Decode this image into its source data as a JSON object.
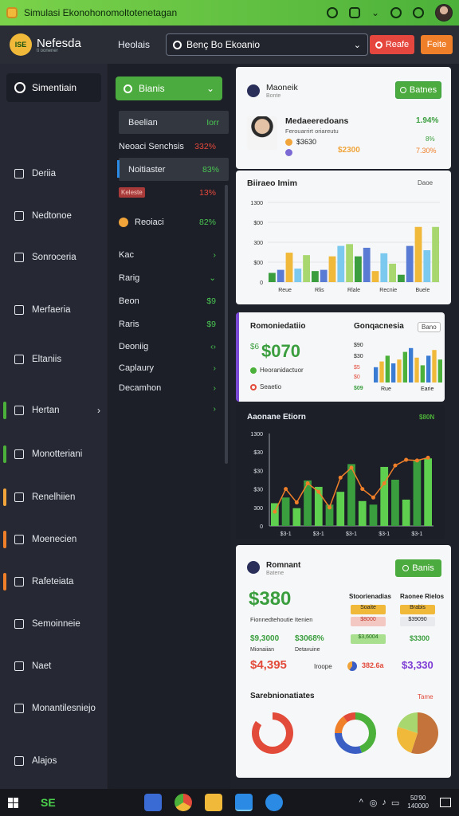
{
  "window": {
    "title": "Simulasi Ekonohonomoltotenetagan"
  },
  "header": {
    "brand": "Nefesda",
    "brand_sub": "ti oonener",
    "logo_text": "ISE",
    "label": "Heolais",
    "search": {
      "value": "Benç  Bo  Ekoanio"
    },
    "btn_red": "Reafe",
    "btn_orange": "Feite"
  },
  "sidebar": {
    "top": "Simentiain",
    "items": [
      {
        "label": "Deriia",
        "icon": "dashboard-icon"
      },
      {
        "label": "Nedtonoe",
        "icon": "notes-icon"
      },
      {
        "label": "Sonroceria",
        "icon": "settings-icon"
      },
      {
        "label": "Merfaeria",
        "icon": "chart-icon"
      },
      {
        "label": "Eltaniis",
        "icon": "gear-icon"
      },
      {
        "label": "Hertan",
        "icon": "folder-icon",
        "accent": "#4cb13a",
        "arrow": "›"
      },
      {
        "label": "Monotteriani",
        "icon": "list-icon",
        "accent": "#4cb13a"
      },
      {
        "label": "Renelhiien",
        "icon": "mail-icon",
        "accent": "#f0a43a"
      },
      {
        "label": "Moenecien",
        "icon": "calendar-icon",
        "accent": "#f07f2a"
      },
      {
        "label": "Rafeteiata",
        "icon": "report-icon",
        "accent": "#f07f2a"
      },
      {
        "label": "Semoinneie",
        "icon": "people-icon"
      },
      {
        "label": "Naet",
        "icon": "globe-icon"
      },
      {
        "label": "Monantilesniejo",
        "icon": "message-icon"
      },
      {
        "label": "Alajos",
        "icon": "help-icon"
      }
    ]
  },
  "mid": {
    "button": "Bianis",
    "rows": [
      {
        "label": "Beelian",
        "value": "Iorr",
        "color": "green",
        "selected": true
      },
      {
        "label": "Neoaci Senchsis",
        "value": "332%",
        "color": "red"
      },
      {
        "label": "Noitiaster",
        "value": "83%",
        "color": "green",
        "selected": true
      },
      {
        "label": "Keleste",
        "value": "13%",
        "color": "red",
        "badge": true
      },
      {
        "label": "Reoiaci",
        "value": "82%",
        "color": "green",
        "coin": true
      },
      {
        "label": "Kac",
        "value": "›",
        "color": "green"
      },
      {
        "label": "Rarig",
        "value": "⌄",
        "color": "green"
      },
      {
        "label": "Beon",
        "value": "$9",
        "color": "green"
      },
      {
        "label": "Raris",
        "value": "$9",
        "color": "green"
      },
      {
        "label": "Deoniig",
        "value": "‹›",
        "color": "green"
      },
      {
        "label": "Caplaury",
        "value": "›",
        "color": "green"
      },
      {
        "label": "Decamhon",
        "value": "›",
        "color": "green"
      },
      {
        "label": "",
        "value": "›",
        "color": "green"
      }
    ]
  },
  "card1": {
    "title": "Maoneik",
    "sub": "Bonte",
    "button": "Batnes",
    "name": "Medaeeredoans",
    "line": "Ferouarrirt oriareutu",
    "amount": "$3630",
    "stat1": "1.94%",
    "stat2": "8%",
    "stat3": "$2300",
    "stat4": "7.30%"
  },
  "chart1": {
    "title": "Biiraeo Imim",
    "corner": "Daoe"
  },
  "card2": {
    "title": "Romoniedatiio",
    "mid_title": "Gonqacnesia",
    "tag": "Bano",
    "big_value": "$070",
    "big_prefix": "$6",
    "line1": "Heoranidactuor",
    "line2": "Seaetio",
    "yl": [
      "$90",
      "$30",
      "$5",
      "$0"
    ],
    "xl": [
      "$09",
      "Rue",
      "Earie"
    ]
  },
  "chart2": {
    "title": "Aaonane Etiorn",
    "corner": "$80N"
  },
  "card3": {
    "title": "Romnant",
    "sub": "Batene",
    "button": "Banis",
    "big_value": "$380",
    "big_sub": "Fionnedtehoutie Itenien",
    "h1": "Stoorienadias",
    "h2": "Raonee Rielos",
    "pills": [
      "Soaite",
      "Brabis",
      "$8000",
      "$39090"
    ],
    "v1": "$9,3000",
    "v2": "$3068%",
    "sub1": "Mionaiian",
    "sub2": "Detavuine",
    "red_big": "$4,395",
    "mid_word": "Iroope",
    "mid_value": "382.6a",
    "purple": "$3,330",
    "v3": "$3,6004",
    "v4": "$3300",
    "section": "Sarebnionatiates",
    "section_tag": "Tame"
  },
  "taskbar": {
    "app_label": "SE",
    "time": "50'90",
    "date": "140000"
  },
  "chart_data": [
    {
      "type": "bar",
      "title": "Biiraeo Imim",
      "ylim": [
        0,
        1300
      ],
      "y_ticks": [
        "0",
        "$00",
        "300",
        "$00",
        "1300"
      ],
      "x_ticks": [
        "Reue",
        "Rlis",
        "Rlale",
        "Recnie",
        "Buele"
      ],
      "series": [
        {
          "values": [
            150,
            200,
            480,
            220,
            440,
            180,
            200,
            420,
            590,
            620,
            420,
            560,
            180,
            470,
            300,
            120,
            590,
            900,
            520,
            900
          ]
        }
      ],
      "colors": [
        "#3a9e3e",
        "#5a7bd4",
        "#f0b93a",
        "#7bc9ee",
        "#a8d770"
      ]
    },
    {
      "type": "bar",
      "title": "Gonqacnesia",
      "values": [
        40,
        55,
        70,
        50,
        60,
        80,
        90,
        65,
        45,
        70,
        85,
        60
      ],
      "colors": [
        "#3a7bd4",
        "#f0b93a",
        "#4cb13a"
      ]
    },
    {
      "type": "bar",
      "title": "Aaonane Etiorn",
      "ylim": [
        0,
        1300
      ],
      "y_ticks": [
        "0",
        "300",
        "$30",
        "$30",
        "$30",
        "1300"
      ],
      "x_ticks": [
        "$3-1",
        "$3-1",
        "$3-1",
        "$3-1",
        "$3-1"
      ],
      "bars": [
        320,
        400,
        250,
        640,
        550,
        300,
        480,
        870,
        350,
        300,
        830,
        650,
        370,
        930,
        950
      ],
      "line": [
        200,
        520,
        330,
        600,
        480,
        260,
        680,
        820,
        520,
        400,
        600,
        850,
        930,
        920,
        960
      ]
    },
    {
      "type": "pie",
      "title": "Sarebnionatiates",
      "charts": [
        {
          "values": [
            85,
            15
          ],
          "colors": [
            "#e24a3a",
            "#f6f7f8"
          ]
        },
        {
          "values": [
            45,
            30,
            15,
            10
          ],
          "colors": [
            "#4cb13a",
            "#3a5ec4",
            "#f07f2a",
            "#e24a3a"
          ]
        },
        {
          "values": [
            55,
            25,
            20
          ],
          "colors": [
            "#c4743a",
            "#f0b93a",
            "#a8d770"
          ]
        }
      ]
    }
  ]
}
